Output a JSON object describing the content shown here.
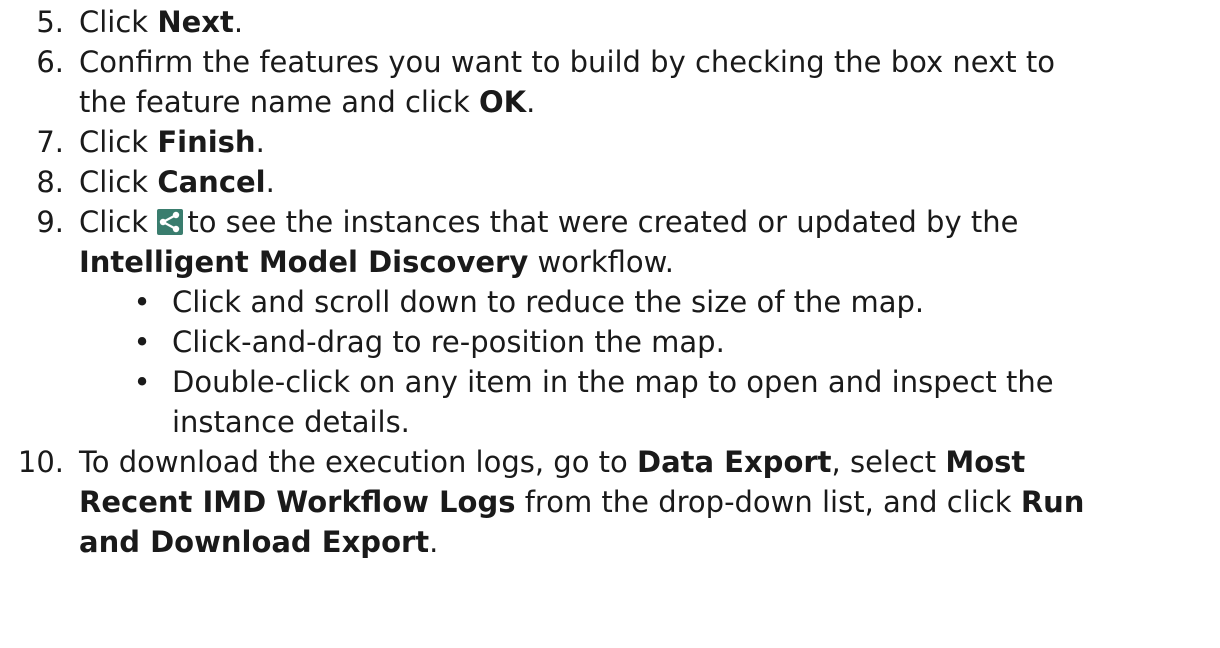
{
  "steps": [
    {
      "number": "5.",
      "parts": {
        "a": "Click ",
        "b": "Next",
        "c": "."
      }
    },
    {
      "number": "6.",
      "line1": "Confirm the features you want to build by checking the box next to",
      "line2": {
        "a": "the feature name and click ",
        "b": "OK",
        "c": "."
      }
    },
    {
      "number": "7.",
      "parts": {
        "a": "Click ",
        "b": "Finish",
        "c": "."
      }
    },
    {
      "number": "8.",
      "parts": {
        "a": "Click ",
        "b": "Cancel",
        "c": "."
      }
    },
    {
      "number": "9.",
      "line1": {
        "a": "Click ",
        "icon": "share-icon",
        "b": "to see the instances that were created or updated by the"
      },
      "line2": {
        "a": "Intelligent Model Discovery",
        "b": " workflow."
      },
      "bullets": [
        "Click and scroll down to reduce the size of the map.",
        "Click-and-drag to re-position the map.",
        {
          "line1": "Double-click on any item in the map to open and inspect the",
          "line2": "instance details."
        }
      ]
    },
    {
      "number": "10.",
      "line1": {
        "a": "To download the execution logs, go to ",
        "b": "Data Export",
        "c": ", select ",
        "d": "Most"
      },
      "line2": {
        "a": "Recent IMD Workflow Logs",
        "b": " from the drop-down list, and click ",
        "c": "Run"
      },
      "line3": {
        "a": "and Download Export",
        "b": "."
      }
    }
  ],
  "icon_color": "#3a7d6e"
}
